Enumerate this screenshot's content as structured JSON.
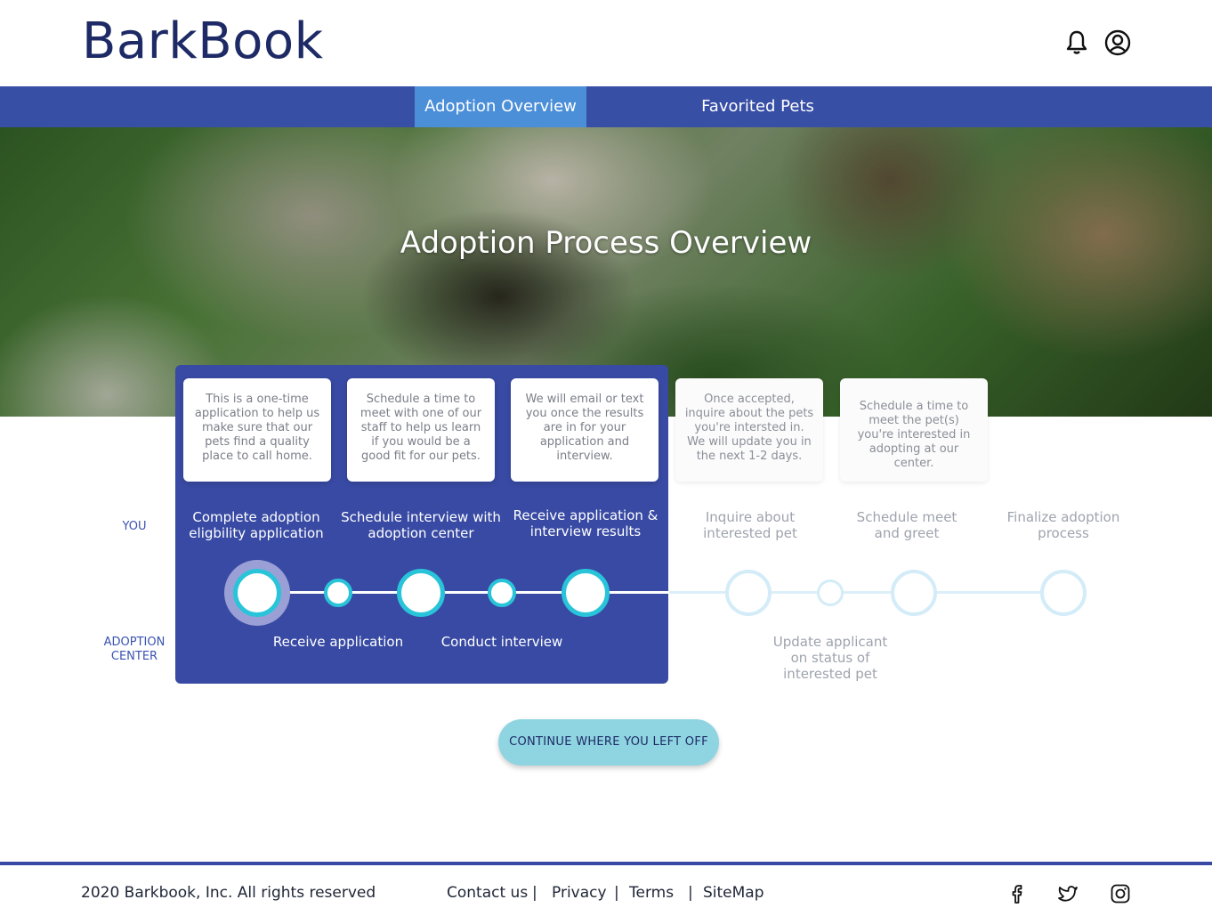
{
  "header": {
    "logo": "BarkBook",
    "icons": [
      "bell-icon",
      "user-icon"
    ]
  },
  "nav": {
    "tabs": [
      {
        "label": "Adoption Overview",
        "active": true
      },
      {
        "label": "Favorited Pets",
        "active": false
      }
    ]
  },
  "hero": {
    "title": "Adoption Process Overview"
  },
  "rows": {
    "you": "YOU",
    "center": "ADOPTION CENTER"
  },
  "cards": [
    "This is a one-time application to help us make sure that our pets find a quality place to call home.",
    "Schedule a time to meet with one of our staff to help us learn if you would be a good fit for our pets.",
    "We will email or text you once the results are in for your application and interview.",
    "Once accepted, inquire about the pets you're intersted in. We will update you in the next 1-2 days.",
    "Schedule a time to meet the pet(s) you're interested in adopting at our center."
  ],
  "you_steps": [
    "Complete adoption eligbility application",
    "Schedule interview with adoption center",
    "Receive application & interview results",
    "Inquire about interested pet",
    "Schedule meet and greet",
    "Finalize adoption process"
  ],
  "center_steps": [
    "Receive application",
    "Conduct interview",
    "Update applicant on status of interested pet"
  ],
  "cta": {
    "label": "CONTINUE WHERE YOU LEFT OFF"
  },
  "colors": {
    "primary": "#384aa3",
    "accent": "#29c4d9",
    "active_tab": "#4c8fd9",
    "faded_node": "#d3ecf8"
  },
  "footer": {
    "copyright": "2020 Barkbook, Inc. All rights reserved",
    "links": [
      "Contact us",
      "Privacy",
      "Terms",
      "SiteMap"
    ],
    "separator": "|",
    "social": [
      "facebook-icon",
      "twitter-icon",
      "instagram-icon"
    ]
  }
}
